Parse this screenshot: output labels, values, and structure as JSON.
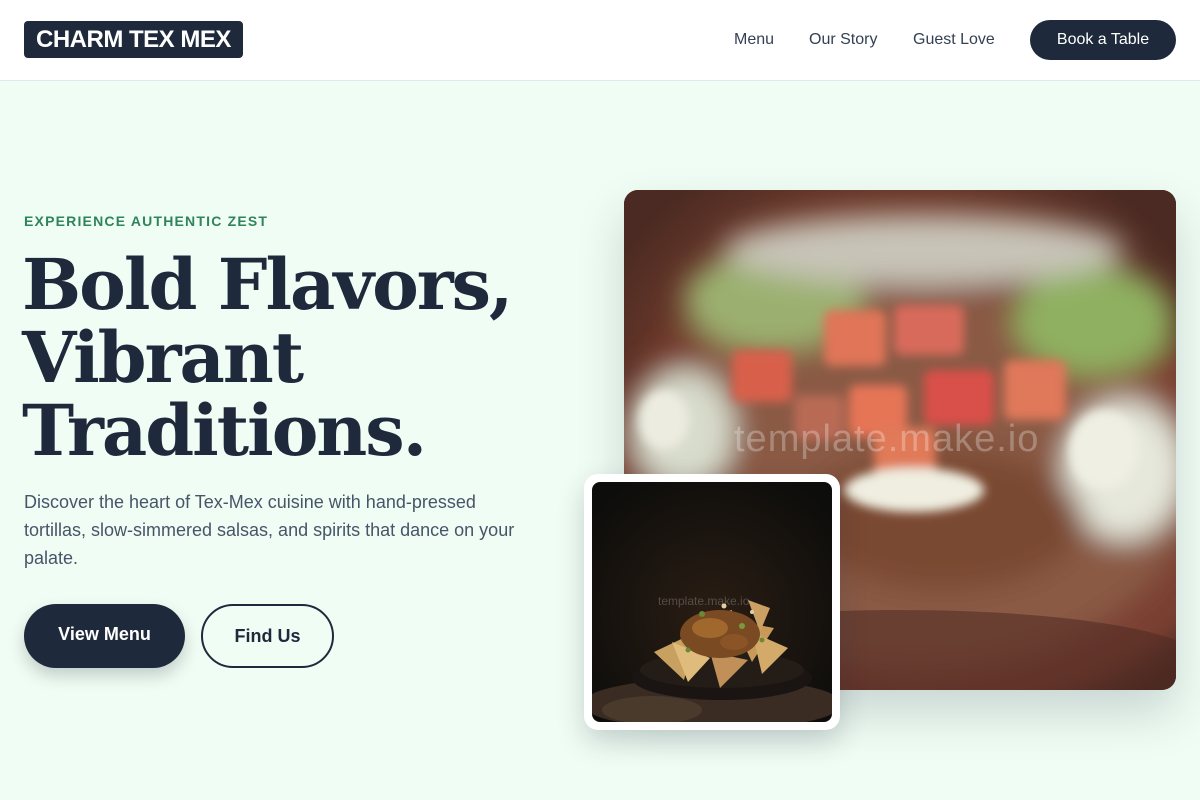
{
  "header": {
    "logo": "CHARM TEX MEX",
    "nav": [
      "Menu",
      "Our Story",
      "Guest Love"
    ],
    "cta": "Book a Table"
  },
  "hero": {
    "eyebrow": "EXPERIENCE AUTHENTIC ZEST",
    "headline": [
      "Bold Flavors,",
      "Vibrant",
      "Traditions."
    ],
    "description": "Discover the heart of Tex-Mex cuisine with hand-pressed tortillas, slow-simmered salsas, and spirits that dance on your palate.",
    "primary_button": "View Menu",
    "secondary_button": "Find Us"
  },
  "images": {
    "main_watermark": "template.make.io",
    "small_watermark": "template.make.io"
  },
  "colors": {
    "page_bg": "#f0fdf4",
    "navy": "#1e293b",
    "accent_green": "#2f855a",
    "body_text": "#475569"
  }
}
